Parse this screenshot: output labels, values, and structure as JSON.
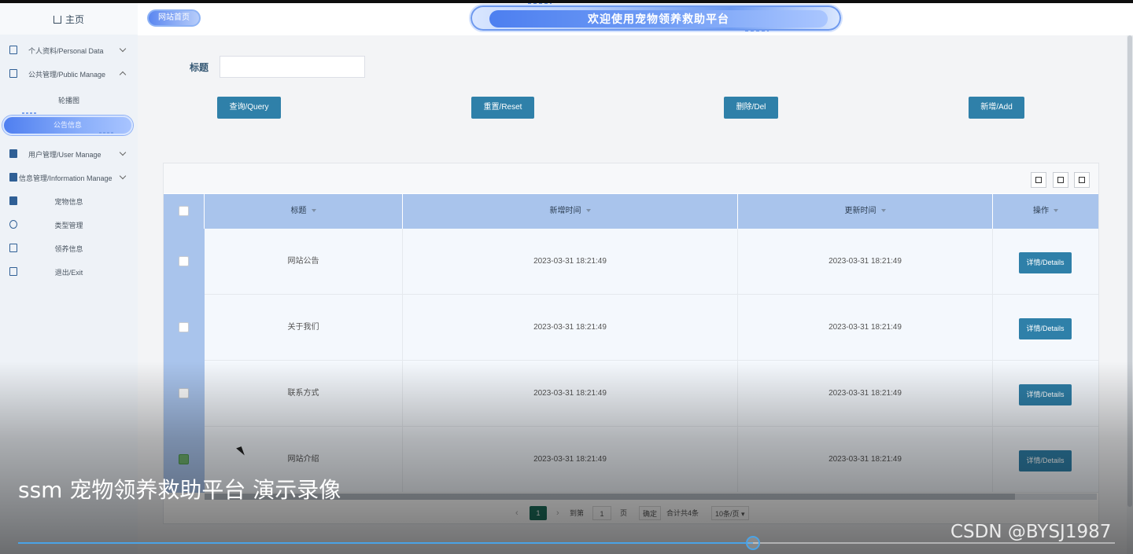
{
  "sidebar": {
    "home": "主页",
    "menu": [
      {
        "label": "个人资料/Personal Data",
        "icon": "document-icon",
        "expanded": false
      },
      {
        "label": "公共管理/Public Manage",
        "icon": "clipboard-icon",
        "expanded": true
      },
      {
        "label": "用户管理/User Manage",
        "icon": "user-chart-icon",
        "expanded": false
      },
      {
        "label": "信息管理/Information Manage",
        "icon": "bar-chart-icon",
        "expanded": false
      },
      {
        "label": "宠物信息",
        "icon": "bookmark-icon"
      },
      {
        "label": "类型管理",
        "icon": "search-person-icon"
      },
      {
        "label": "领养信息",
        "icon": "calendar-icon"
      },
      {
        "label": "退出/Exit",
        "icon": "calendar-check-icon"
      }
    ],
    "submenu": [
      {
        "label": "轮播图"
      },
      {
        "label": "公告信息",
        "active": true
      }
    ]
  },
  "header": {
    "home_button": "网站首页",
    "banner_title": "欢迎使用宠物领养救助平台"
  },
  "search": {
    "label": "标题",
    "value": "",
    "buttons": [
      "查询/Query",
      "重置/Reset",
      "删除/Del",
      "新增/Add"
    ]
  },
  "table": {
    "columns": [
      "标题",
      "新增时间",
      "更新时间",
      "操作"
    ],
    "rows": [
      {
        "title": "网站公告",
        "created": "2023-03-31 18:21:49",
        "updated": "2023-03-31 18:21:49",
        "action": "详情/Details",
        "checked": false
      },
      {
        "title": "关于我们",
        "created": "2023-03-31 18:21:49",
        "updated": "2023-03-31 18:21:49",
        "action": "详情/Details",
        "checked": false
      },
      {
        "title": "联系方式",
        "created": "2023-03-31 18:21:49",
        "updated": "2023-03-31 18:21:49",
        "action": "详情/Details",
        "checked": false
      },
      {
        "title": "网站介绍",
        "created": "2023-03-31 18:21:49",
        "updated": "2023-03-31 18:21:49",
        "action": "详情/Details",
        "checked": true
      }
    ]
  },
  "pagination": {
    "current_page": "1",
    "goto_label": "到第",
    "goto_value": "1",
    "page_unit": "页",
    "confirm": "确定",
    "total": "合计共4条",
    "page_size": "10条/页"
  },
  "video": {
    "title": "ssm 宠物领养救助平台 演示录像",
    "watermark": "CSDN @BYSJ1987",
    "progress": 0.67
  },
  "colors": {
    "accent": "#2f80a9",
    "header_row": "#a9c4ec",
    "sidebar_bg": "#eef2f7",
    "page_active": "#1c6e5b",
    "progress": "#4aa3e6"
  }
}
